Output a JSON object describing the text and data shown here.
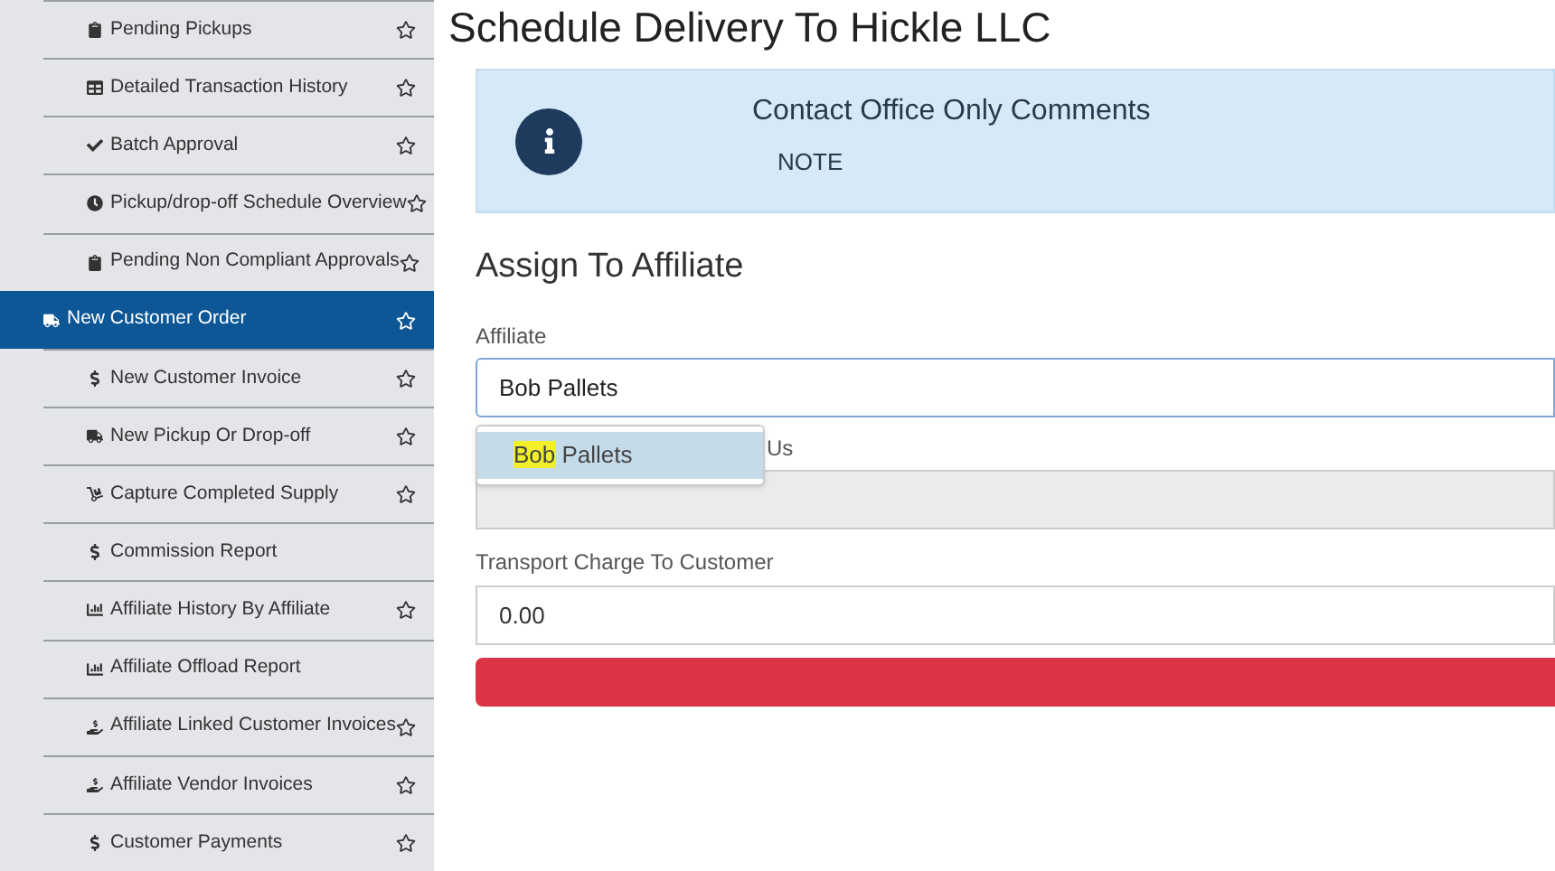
{
  "sidebar": {
    "items": [
      {
        "label": "Pending Pickups",
        "kind": "clipboard",
        "star": true,
        "selected": false
      },
      {
        "label": "Detailed Transaction History",
        "kind": "table",
        "star": true,
        "selected": false
      },
      {
        "label": "Batch Approval",
        "kind": "check",
        "star": true,
        "selected": false
      },
      {
        "label": "Pickup/drop-off Schedule Overview",
        "kind": "clock",
        "star": true,
        "selected": false
      },
      {
        "label": "Pending Non Compliant Approvals",
        "kind": "clipboard",
        "star": true,
        "selected": false
      },
      {
        "label": "New Customer Order",
        "kind": "truck",
        "star": true,
        "selected": true
      },
      {
        "label": "New Customer Invoice",
        "kind": "dollar",
        "star": true,
        "selected": false
      },
      {
        "label": "New Pickup Or Drop-off",
        "kind": "truck",
        "star": true,
        "selected": false
      },
      {
        "label": "Capture Completed Supply",
        "kind": "cart",
        "star": true,
        "selected": false
      },
      {
        "label": "Commission Report",
        "kind": "dollar",
        "star": false,
        "selected": false
      },
      {
        "label": "Affiliate History By Affiliate",
        "kind": "chart",
        "star": true,
        "selected": false
      },
      {
        "label": "Affiliate Offload Report",
        "kind": "chart",
        "star": false,
        "selected": false
      },
      {
        "label": "Affiliate Linked Customer Invoices",
        "kind": "hand",
        "star": true,
        "selected": false
      },
      {
        "label": "Affiliate Vendor Invoices",
        "kind": "hand",
        "star": true,
        "selected": false
      },
      {
        "label": "Customer Payments",
        "kind": "dollar",
        "star": true,
        "selected": false
      }
    ]
  },
  "page": {
    "title": "Schedule Delivery To Hickle LLC"
  },
  "note": {
    "heading": "Contact Office Only Comments",
    "text": "NOTE"
  },
  "section": {
    "title": "Assign To Affiliate"
  },
  "affiliate": {
    "label": "Affiliate",
    "value": "Bob Pallets",
    "suggestions": [
      {
        "match": "Bob",
        "rest": " Pallets",
        "selected": true
      }
    ]
  },
  "hidden_field": {
    "label_visible_part": "Us",
    "disabled": true
  },
  "transport": {
    "label": "Transport Charge To Customer",
    "value": "0.00"
  }
}
